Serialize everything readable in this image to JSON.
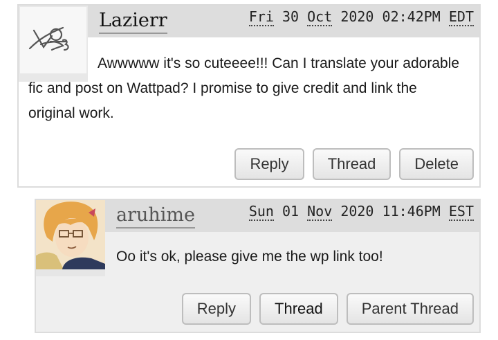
{
  "comments": [
    {
      "username": "Lazierr",
      "date": {
        "weekday": "Fri",
        "day": "30",
        "month": "Oct",
        "year": "2020",
        "time": "02:42PM",
        "tz": "EDT"
      },
      "icon": "scribble-avatar-icon",
      "text": "Awwwww it's so cuteeee!!! Can I translate your adorable fic and post on Wattpad? I promise to give credit and link the original work.",
      "buttons": [
        "Reply",
        "Thread",
        "Delete"
      ]
    },
    {
      "username": "aruhime",
      "date": {
        "weekday": "Sun",
        "day": "01",
        "month": "Nov",
        "year": "2020",
        "time": "11:46PM",
        "tz": "EST"
      },
      "icon": "anime-boy-avatar",
      "text": "Oo it's ok, please give me the wp link too!",
      "buttons": [
        "Reply",
        "Thread",
        "Parent Thread"
      ]
    }
  ],
  "colors": {
    "header_bg": "#dddddd",
    "reply_bg": "#efefef",
    "border": "#dcdcdc"
  }
}
